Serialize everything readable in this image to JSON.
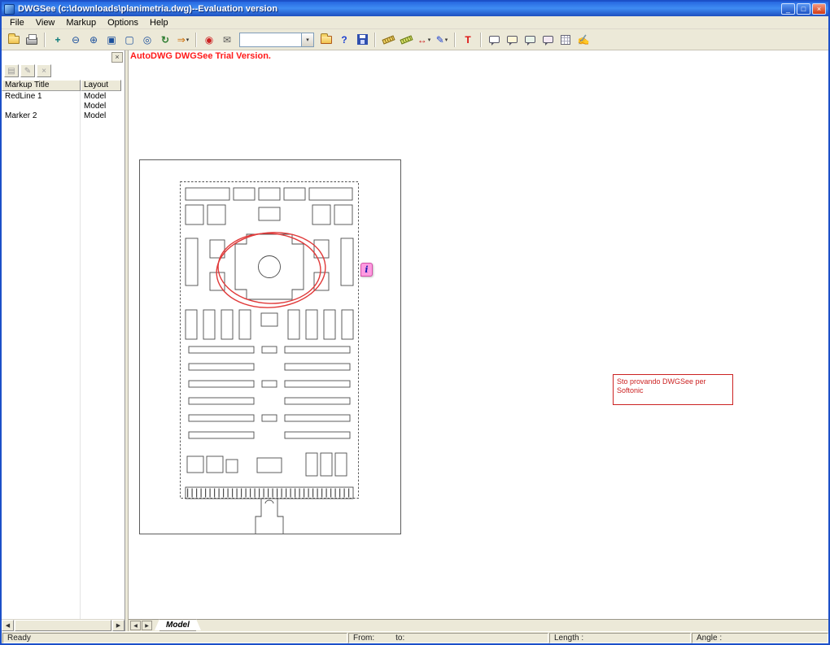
{
  "window": {
    "title": "DWGSee (c:\\downloads\\planimetria.dwg)--Evaluation version",
    "controls": {
      "minimize": "_",
      "maximize": "□",
      "close": "×"
    }
  },
  "menu": {
    "items": [
      "File",
      "View",
      "Markup",
      "Options",
      "Help"
    ]
  },
  "toolbar": {
    "combo_value": "",
    "glyphs": {
      "pan": "+",
      "zoom_out": "⊖",
      "zoom_in": "⊕",
      "zoom_window": "▣",
      "zoom_extents": "▢",
      "zoom_magnifier": "◎",
      "refresh": "↻",
      "next_view": "⇒",
      "dropdown": "▾",
      "website": "◉",
      "send": "✉",
      "help": "?",
      "dimension": "↔",
      "pen": "✎",
      "text": "T",
      "redline_hand": "✍"
    }
  },
  "trial_notice": "AutoDWG DWGSee Trial Version.",
  "markup_panel": {
    "buttons": {
      "view": "▤",
      "edit": "✎",
      "delete": "×",
      "close": "×"
    },
    "columns": [
      "Markup Title",
      "Layout"
    ],
    "rows": [
      {
        "title": "RedLine 1",
        "layout": "Model"
      },
      {
        "title": "",
        "layout": "Model"
      },
      {
        "title": "Marker 2",
        "layout": "Model"
      }
    ],
    "scroll": {
      "left": "◀",
      "right": "▶"
    }
  },
  "canvas": {
    "annotation_text": "Sto provando DWGSee per Softonic",
    "marker_label": "i"
  },
  "tabs": {
    "prev": "◀",
    "next": "▶",
    "model_label": "Model"
  },
  "statusbar": {
    "ready": "Ready",
    "from_label": "From:",
    "to_label": "to:",
    "length_label": "Length :",
    "angle_label": "Angle :"
  },
  "colors": {
    "titlebar_blue": "#2a63d8",
    "trial_red": "#ff1a1a",
    "annotation_red": "#cc2222",
    "marker_pink": "#ff9ae0",
    "markup_red": "#e03a3a"
  }
}
